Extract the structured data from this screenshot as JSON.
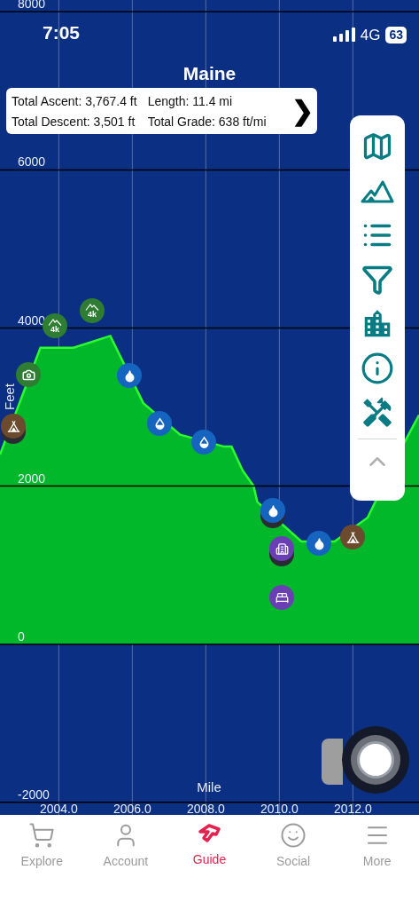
{
  "status_bar": {
    "time": "7:05",
    "network": "4G",
    "battery": "63"
  },
  "title": "Maine",
  "stats": {
    "total_ascent": "Total Ascent: 3,767.4 ft",
    "length": "Length: 11.4 mi",
    "total_descent": "Total Descent: 3,501 ft",
    "total_grade": "Total Grade: 638 ft/mi",
    "next": "❯"
  },
  "toolbar": [
    {
      "kind": "map"
    },
    {
      "kind": "mountains"
    },
    {
      "kind": "list"
    },
    {
      "kind": "filter"
    },
    {
      "kind": "buildings"
    },
    {
      "kind": "info"
    },
    {
      "kind": "tools"
    },
    {
      "kind": "collapse"
    }
  ],
  "profile": {
    "chart_data": {
      "type": "area",
      "xlabel": "Mile",
      "ylabel": "Feet",
      "grid": true,
      "x": [
        2002.4,
        2003.5,
        2004.4,
        2005.4,
        2006.3,
        2007.3,
        2008.5,
        2008.7,
        2009.0,
        2009.3,
        2009.4,
        2010.6,
        2011.5,
        2012.4,
        2013.4,
        2013.8
      ],
      "series": [
        {
          "color": "#00b82a",
          "values": [
            2400,
            3750,
            3750,
            3900,
            3050,
            2650,
            2500,
            2500,
            2200,
            2000,
            1800,
            1300,
            1300,
            1600,
            2550,
            2900
          ]
        }
      ],
      "xlim": [
        2002.4,
        2013.8
      ],
      "ylim": [
        -3350,
        8150
      ],
      "xticks": [
        {
          "value": 2004,
          "label": "2004.0"
        },
        {
          "value": 2006,
          "label": "2006.0"
        },
        {
          "value": 2008,
          "label": "2008.0"
        },
        {
          "value": 2010,
          "label": "2010.0"
        },
        {
          "value": 2012,
          "label": "2012.0"
        }
      ],
      "yticks": [
        -2000,
        0,
        2000,
        4000,
        6000,
        8000
      ]
    },
    "markers": [
      {
        "kind": "camp",
        "stacked": true
      },
      {
        "kind": "camera",
        "stacked": false
      },
      {
        "kind": "peak",
        "label": "4k",
        "stacked": false
      },
      {
        "kind": "peak",
        "label": "4k",
        "stacked": false
      },
      {
        "kind": "water",
        "stacked": false
      },
      {
        "kind": "water-half",
        "stacked": false
      },
      {
        "kind": "water-half",
        "stacked": false
      },
      {
        "kind": "water",
        "stacked": true
      },
      {
        "kind": "building",
        "stacked": true
      },
      {
        "kind": "lodging",
        "stacked": false
      },
      {
        "kind": "water",
        "stacked": false
      },
      {
        "kind": "camp",
        "stacked": false
      }
    ]
  },
  "tab_bar": [
    {
      "kind": "cart",
      "label": "Explore",
      "selected": false
    },
    {
      "kind": "person",
      "label": "Account",
      "selected": false
    },
    {
      "kind": "guide",
      "label": "Guide",
      "selected": true
    },
    {
      "kind": "smile",
      "label": "Social",
      "selected": false
    },
    {
      "kind": "menu",
      "label": "More",
      "selected": false
    }
  ]
}
